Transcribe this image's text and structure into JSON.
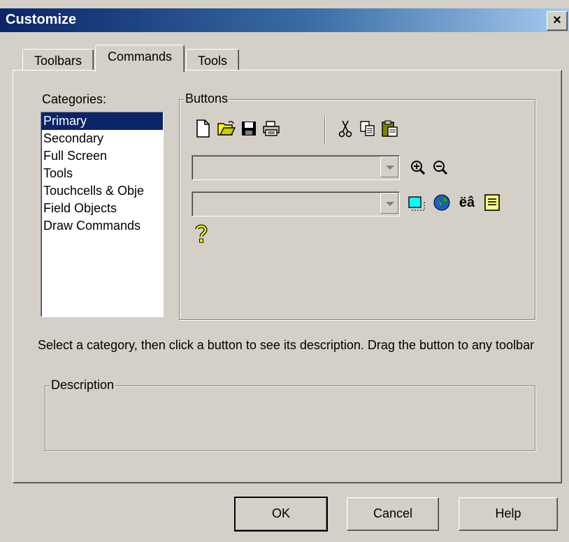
{
  "window": {
    "title": "Customize",
    "close": "✕"
  },
  "tabs": [
    "Toolbars",
    "Commands",
    "Tools"
  ],
  "categories": {
    "label": "Categories:",
    "items": [
      "Primary",
      "Secondary",
      "Full Screen",
      "Tools",
      "Touchcells & Obje",
      "Field Objects",
      "Draw Commands"
    ],
    "selected": "Primary"
  },
  "buttons": {
    "label": "Buttons",
    "row1": [
      "new-file-icon",
      "open-folder-icon",
      "save-disk-icon",
      "print-icon",
      "cut-icon",
      "copy-icon",
      "paste-icon"
    ],
    "row2": [
      "zoom-in-icon",
      "zoom-out-icon"
    ],
    "row3": [
      "screen-rect-icon",
      "globe-icon",
      "language-text-icon",
      "text-box-icon"
    ],
    "row3_text_glyph": "ëâ",
    "row4": [
      "help-question-icon"
    ]
  },
  "hint": "Select a category, then click a button to see its description. Drag the button to any toolbar",
  "description": {
    "label": "Description",
    "text": ""
  },
  "actions": {
    "ok": "OK",
    "cancel": "Cancel",
    "help": "Help"
  }
}
